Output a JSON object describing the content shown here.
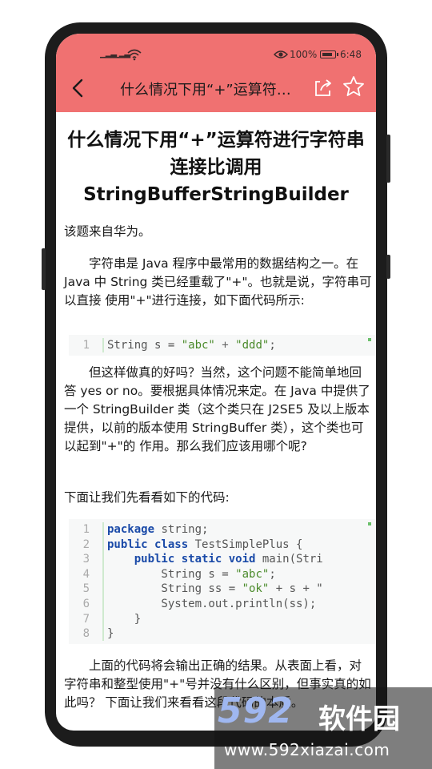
{
  "status_bar": {
    "signal1": "ᵃᴵᴵ",
    "signal2": "ᵃᴵᴵ",
    "battery_percent": "100%",
    "time": "6:48"
  },
  "nav": {
    "title": "什么情况下用“+”运算符进行字符串连接比调用StringBufferStringBuilder"
  },
  "article": {
    "title": "什么情况下用“+”运算符进行字符串连接比调用StringBufferStringBuilder",
    "source": "该题来自华为。",
    "para1": "字符串是 Java 程序中最常用的数据结构之一。在 Java 中 String 类已经重载了\"+\"。也就是说，字符串可以直接 使用\"+\"进行连接，如下面代码所示:",
    "para2": "但这样做真的好吗？当然，这个问题不能简单地回答 yes or no。要根据具体情况来定。在 Java 中提供了一个 StringBuilder 类（这个类只在 J2SE5 及以上版本提供，以前的版本使用 StringBuffer 类），这个类也可以起到\"+\"的 作用。那么我们应该用哪个呢?",
    "para3": "下面让我们先看看如下的代码:",
    "para4": "上面的代码将会输出正确的结果。从表面上看，对字符串和整型使用\"+\"号并没有什么区别，但事实真的如此吗？ 下面让我们来看看这段代码的本质。",
    "code1": {
      "line_numbers": [
        "1"
      ],
      "lines": [
        {
          "k": "",
          "t": "String s = ",
          "s": "\"abc\"",
          "r": " + ",
          "s2": "\"ddd\"",
          "e": ";"
        }
      ]
    },
    "code2": {
      "line_numbers": [
        "1",
        "2",
        "3",
        "4",
        "5",
        "6",
        "7",
        "8"
      ],
      "line1_kw": "package",
      "line1_rest": " string;",
      "line2_kw": "public class",
      "line2_rest": " TestSimplePlus {",
      "line3_indent": "    ",
      "line3_kw": "public static void",
      "line3_rest": " main(Stri",
      "line4_pre": "        String s = ",
      "line4_str": "\"abc\"",
      "line4_end": ";",
      "line5_pre": "        String ss = ",
      "line5_str": "\"ok\"",
      "line5_end": " + s + \"",
      "line6": "        System.out.println(ss);",
      "line7": "    }",
      "line8": "}"
    }
  },
  "watermark": {
    "logo": "592",
    "brand": "软件园",
    "url": "www.592xiazai.com"
  },
  "colors": {
    "header": "#f07171",
    "keyword": "#1a4aa8",
    "string": "#4a8a2a"
  },
  "icons": [
    "back-arrow-icon",
    "share-icon",
    "star-icon",
    "wifi-icon",
    "eye-icon",
    "battery-icon"
  ]
}
